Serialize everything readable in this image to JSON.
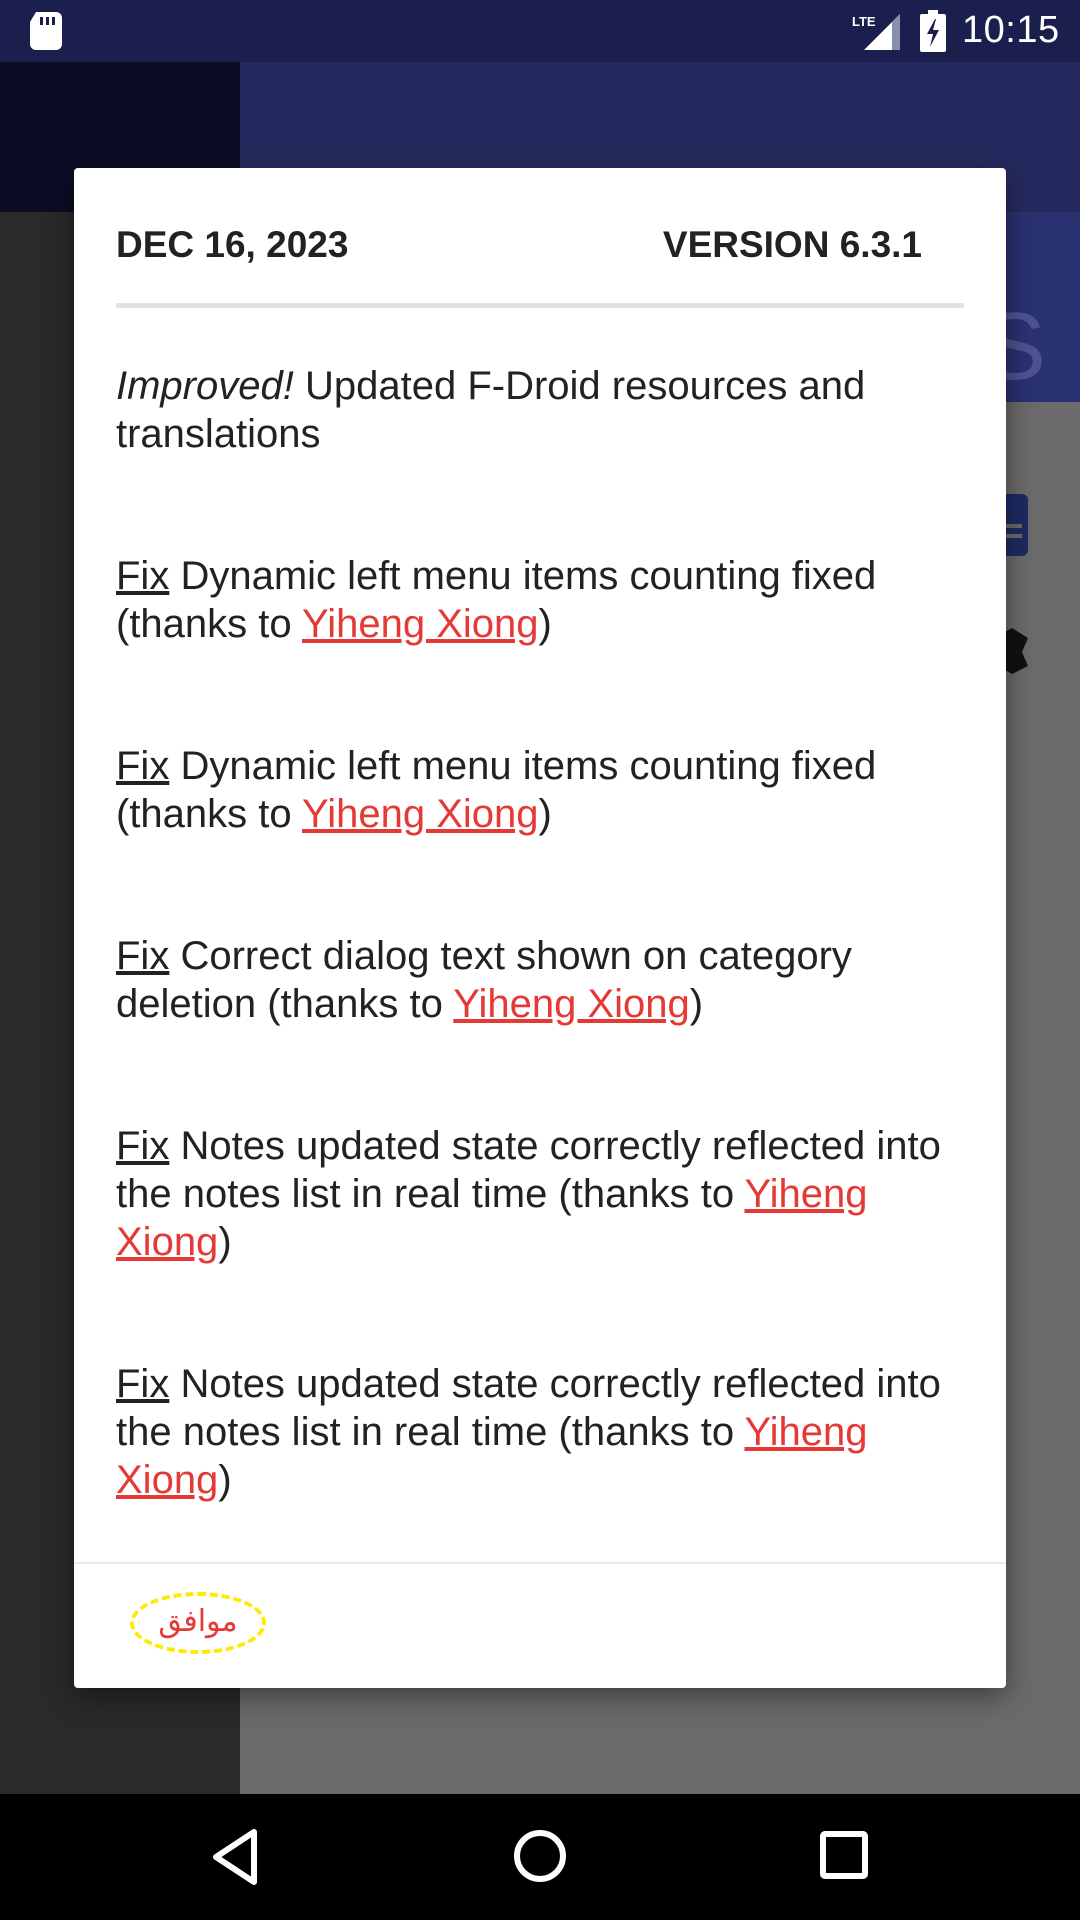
{
  "status_bar": {
    "time": "10:15",
    "network": "LTE",
    "icons": [
      "sd-card-icon",
      "lte-signal-icon",
      "battery-charging-icon"
    ]
  },
  "dialog": {
    "date": "DEC 16, 2023",
    "version": "VERSION 6.3.1",
    "items": [
      {
        "tag": "Improved!",
        "text": " Updated F-Droid resources and translations",
        "credit": ""
      },
      {
        "tag": "Fix",
        "text": " Dynamic left menu items counting fixed (thanks to ",
        "credit": "Yiheng Xiong",
        "end": ")"
      },
      {
        "tag": "Fix",
        "text": " Dynamic left menu items counting fixed (thanks to ",
        "credit": "Yiheng Xiong",
        "end": ")"
      },
      {
        "tag": "Fix",
        "text": " Correct dialog text shown on category deletion (thanks to ",
        "credit": "Yiheng Xiong",
        "end": ")"
      },
      {
        "tag": "Fix",
        "text": " Notes updated state correctly reflected into the notes list in real time (thanks to ",
        "credit": "Yiheng Xiong",
        "end": ")"
      },
      {
        "tag": "Fix",
        "text": " Notes updated state correctly reflected into the notes list in real time (thanks to ",
        "credit": "Yiheng Xiong",
        "end": ")"
      }
    ],
    "ok_label": "موافق"
  },
  "background": {
    "header_letter": "S"
  },
  "colors": {
    "accent_link": "#e53935",
    "status_bar": "#1a1f4d",
    "highlight": "#ffea00"
  },
  "nav_bar": {
    "icons": [
      "back-icon",
      "home-icon",
      "recent-apps-icon"
    ]
  }
}
